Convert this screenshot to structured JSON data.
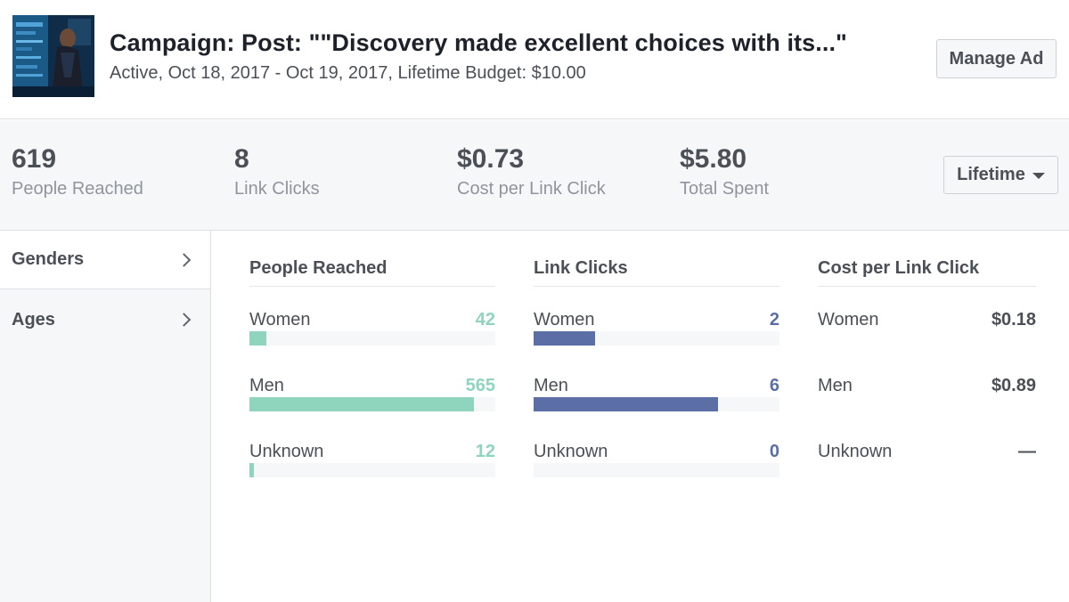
{
  "campaign": {
    "title": "Campaign: Post: \"\"Discovery made excellent choices with its...\"",
    "subtitle": "Active, Oct 18, 2017 - Oct 19, 2017, Lifetime Budget: $10.00",
    "manage_label": "Manage Ad"
  },
  "stats": [
    {
      "value": "619",
      "label": "People Reached"
    },
    {
      "value": "8",
      "label": "Link Clicks"
    },
    {
      "value": "$0.73",
      "label": "Cost per Link Click"
    },
    {
      "value": "$5.80",
      "label": "Total Spent"
    }
  ],
  "range_selector": {
    "label": "Lifetime"
  },
  "sidebar": {
    "items": [
      {
        "label": "Genders"
      },
      {
        "label": "Ages"
      }
    ]
  },
  "breakdown": {
    "people_reached": {
      "title": "People Reached",
      "color": "#8fd4bd",
      "rows": [
        {
          "label": "Women",
          "value": "42",
          "fraction": 0.068
        },
        {
          "label": "Men",
          "value": "565",
          "fraction": 0.913
        },
        {
          "label": "Unknown",
          "value": "12",
          "fraction": 0.019
        }
      ]
    },
    "link_clicks": {
      "title": "Link Clicks",
      "color": "#5b6fa6",
      "rows": [
        {
          "label": "Women",
          "value": "2",
          "fraction": 0.25
        },
        {
          "label": "Men",
          "value": "6",
          "fraction": 0.75
        },
        {
          "label": "Unknown",
          "value": "0",
          "fraction": 0
        }
      ]
    },
    "cost_per_link_click": {
      "title": "Cost per Link Click",
      "rows": [
        {
          "label": "Women",
          "value": "$0.18"
        },
        {
          "label": "Men",
          "value": "$0.89"
        },
        {
          "label": "Unknown",
          "value": "—"
        }
      ]
    }
  }
}
